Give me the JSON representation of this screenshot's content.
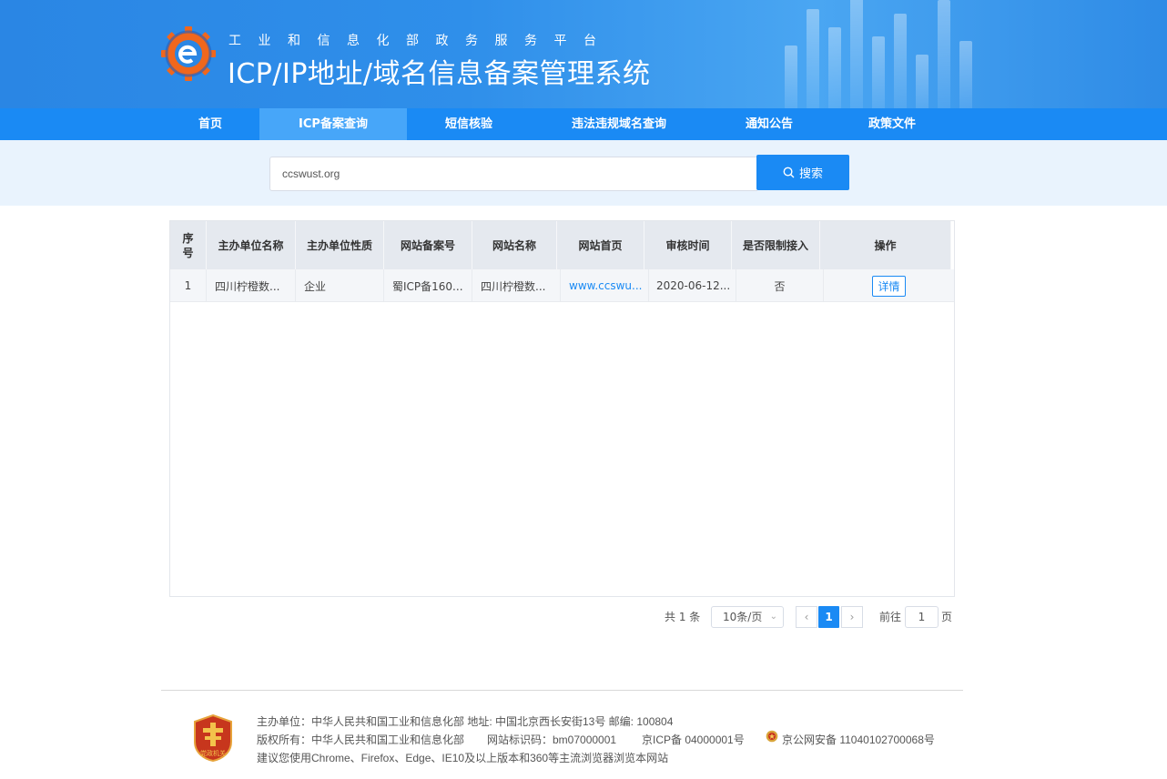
{
  "header": {
    "subtitle": "工业和信息化部政务服务平台",
    "title": "ICP/IP地址/域名信息备案管理系统",
    "logo_icon": "gear-e-logo-icon"
  },
  "nav": {
    "items": [
      {
        "label": "首页",
        "active": false
      },
      {
        "label": "ICP备案查询",
        "active": true
      },
      {
        "label": "短信核验",
        "active": false
      },
      {
        "label": "违法违规域名查询",
        "active": false
      },
      {
        "label": "通知公告",
        "active": false
      },
      {
        "label": "政策文件",
        "active": false
      }
    ]
  },
  "search": {
    "value": "ccswust.org",
    "button_label": "搜索",
    "button_icon": "search-icon"
  },
  "table": {
    "columns": [
      "序号",
      "主办单位名称",
      "主办单位性质",
      "网站备案号",
      "网站名称",
      "网站首页",
      "审核时间",
      "是否限制接入",
      "操作"
    ],
    "rows": [
      {
        "index": "1",
        "org_name": "四川柠橙数...",
        "org_type": "企业",
        "icp_no": "蜀ICP备160...",
        "site_name": "四川柠橙数...",
        "homepage": "www.ccswu...",
        "audit_time": "2020-06-12...",
        "restricted": "否",
        "action": "详情"
      }
    ]
  },
  "pagination": {
    "total": "共 1 条",
    "page_size": "10条/页",
    "current_page": "1",
    "goto_label": "前往",
    "goto_value": "1",
    "page_suffix": "页"
  },
  "footer": {
    "line1": "主办单位：中华人民共和国工业和信息化部     地址: 中国北京西长安街13号     邮编: 100804",
    "line2_copyright": "版权所有：中华人民共和国工业和信息化部",
    "line2_site_id": "网站标识码：bm07000001",
    "line2_icp": "京ICP备 04000001号",
    "line2_police": "京公网安备 11040102700068号",
    "line3": "建议您使用Chrome、Firefox、Edge、IE10及以上版本和360等主流浏览器浏览本网站",
    "emblem_text": "党政机关",
    "emblem_icon": "party-government-emblem-icon",
    "police_icon": "police-badge-icon"
  },
  "colors": {
    "primary": "#1a8af4",
    "nav_active": "#47a6f9",
    "search_band": "#e9f3fd",
    "table_header": "#e5e9ef"
  }
}
